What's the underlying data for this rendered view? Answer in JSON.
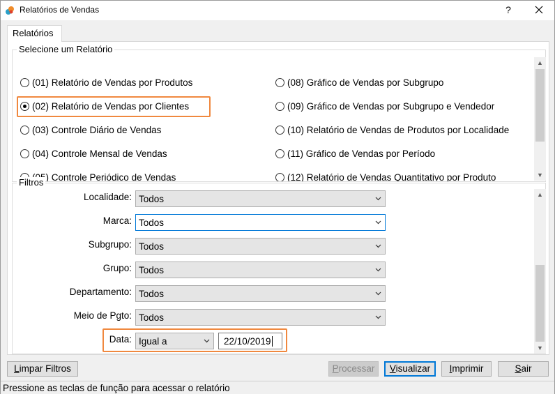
{
  "window": {
    "title": "Relatórios de Vendas",
    "help_glyph": "?",
    "close_glyph": "✕"
  },
  "tab": {
    "label": "Relatórios"
  },
  "report_group": {
    "title": "Selecione um Relatório",
    "left_items": [
      {
        "label": "(01) Relatório de Vendas por Produtos",
        "checked": false
      },
      {
        "label": "(02) Relatório de Vendas por Clientes",
        "checked": true
      },
      {
        "label": "(03) Controle Diário de Vendas",
        "checked": false
      },
      {
        "label": "(04) Controle Mensal de Vendas",
        "checked": false
      },
      {
        "label": "(05) Controle Periódico de Vendas",
        "checked": false
      }
    ],
    "right_items": [
      {
        "label": "(08) Gráfico de Vendas por Subgrupo",
        "checked": false
      },
      {
        "label": "(09) Gráfico de Vendas por Subgrupo e Vendedor",
        "checked": false
      },
      {
        "label": "(10) Relatório de Vendas de Produtos por Localidade",
        "checked": false
      },
      {
        "label": "(11) Gráfico de Vendas por Período",
        "checked": false
      },
      {
        "label": "(12) Relatório de Vendas Quantitativo por Produto",
        "checked": false
      }
    ]
  },
  "filters": {
    "title": "Filtros",
    "localidade": {
      "label": "Localidade:",
      "value": "Todos"
    },
    "marca": {
      "label": "Marca:",
      "value": "Todos"
    },
    "subgrupo": {
      "label": "Subgrupo:",
      "value": "Todos"
    },
    "grupo": {
      "label": "Grupo:",
      "value": "Todos"
    },
    "departamento": {
      "label": "Departamento:",
      "value": "Todos"
    },
    "meio_pgto": {
      "label": "Meio de Pgto:",
      "value": "Todos"
    },
    "data": {
      "label": "Data:",
      "operator": "Igual a",
      "value": "22/10/2019"
    }
  },
  "buttons": {
    "limpar_a": "L",
    "limpar_b": "impar Filtros",
    "processar_a": "P",
    "processar_b": "rocessar",
    "visualizar_a": "V",
    "visualizar_b": "isualizar",
    "imprimir_a": "I",
    "imprimir_b": "mprimir",
    "sair_a": "S",
    "sair_b": "air"
  },
  "status": {
    "text": "Pressione as teclas de função para acessar o relatório"
  },
  "colors": {
    "highlight": "#f0883e",
    "focus": "#0078d7",
    "scroll_thumb": "#cdcdcd"
  },
  "icons": {
    "app": "app-logo-icon",
    "close": "close-icon",
    "dropdown": "chevron-down-icon",
    "scroll_up": "arrow-up-icon",
    "scroll_down": "arrow-down-icon"
  }
}
